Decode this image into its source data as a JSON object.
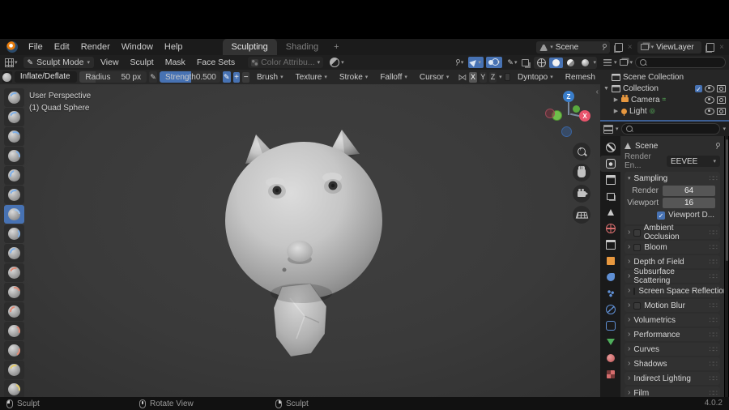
{
  "topbar": {
    "menus": [
      "File",
      "Edit",
      "Render",
      "Window",
      "Help"
    ],
    "tabs": {
      "sculpting": "Sculpting",
      "shading": "Shading",
      "add": "+"
    },
    "scene": {
      "label": "Scene"
    },
    "viewlayer": {
      "label": "ViewLayer"
    },
    "close_x": "×"
  },
  "viewport_header": {
    "mode": "Sculpt Mode",
    "menus": [
      "View",
      "Sculpt",
      "Mask",
      "Face Sets"
    ],
    "color_attribute": "Color Attribu..."
  },
  "tool_settings": {
    "tool_name": "Inflate/Deflate",
    "radius": {
      "label": "Radius",
      "value": "50 px"
    },
    "strength": {
      "label": "Strength",
      "value": "0.500"
    },
    "plus": "+",
    "minus": "−",
    "popovers": [
      "Brush",
      "Texture",
      "Stroke",
      "Falloff",
      "Cursor"
    ],
    "symmetry": {
      "x": "X",
      "y": "Y",
      "z": "Z"
    },
    "dyntopo": "Dyntopo",
    "remesh": "Remesh"
  },
  "viewport": {
    "perspective": "User Perspective",
    "object": "(1) Quad Sphere",
    "axis": {
      "x": "X",
      "z": "Z"
    }
  },
  "outliner": {
    "rows": [
      {
        "label": "Scene Collection"
      },
      {
        "label": "Collection"
      },
      {
        "label": "Camera"
      },
      {
        "label": "Light"
      }
    ]
  },
  "properties": {
    "breadcrumb": "Scene",
    "render_engine": {
      "label": "Render En...",
      "value": "EEVEE"
    },
    "sampling": {
      "title": "Sampling",
      "rows": [
        {
          "label": "Render",
          "value": "64"
        },
        {
          "label": "Viewport",
          "value": "16"
        }
      ],
      "denoise": "Viewport D..."
    },
    "panels": [
      {
        "label": "Ambient Occlusion",
        "has_checkbox": true
      },
      {
        "label": "Bloom",
        "has_checkbox": true
      },
      {
        "label": "Depth of Field",
        "has_checkbox": false
      },
      {
        "label": "Subsurface Scattering",
        "has_checkbox": false
      },
      {
        "label": "Screen Space Reflections",
        "has_checkbox": true
      },
      {
        "label": "Motion Blur",
        "has_checkbox": true
      },
      {
        "label": "Volumetrics",
        "has_checkbox": false
      },
      {
        "label": "Performance",
        "has_checkbox": false
      },
      {
        "label": "Curves",
        "has_checkbox": false
      },
      {
        "label": "Shadows",
        "has_checkbox": false
      },
      {
        "label": "Indirect Lighting",
        "has_checkbox": false
      },
      {
        "label": "Film",
        "has_checkbox": false
      }
    ]
  },
  "statusbar": {
    "lmb": "Sculpt",
    "mmb": "Rotate View",
    "rmb": "Sculpt",
    "version": "4.0.2"
  },
  "colors": {
    "accent": "#4772b3",
    "axis_x": "#e8546c",
    "axis_y": "#6fbf4a",
    "axis_z": "#3a7ecb"
  }
}
